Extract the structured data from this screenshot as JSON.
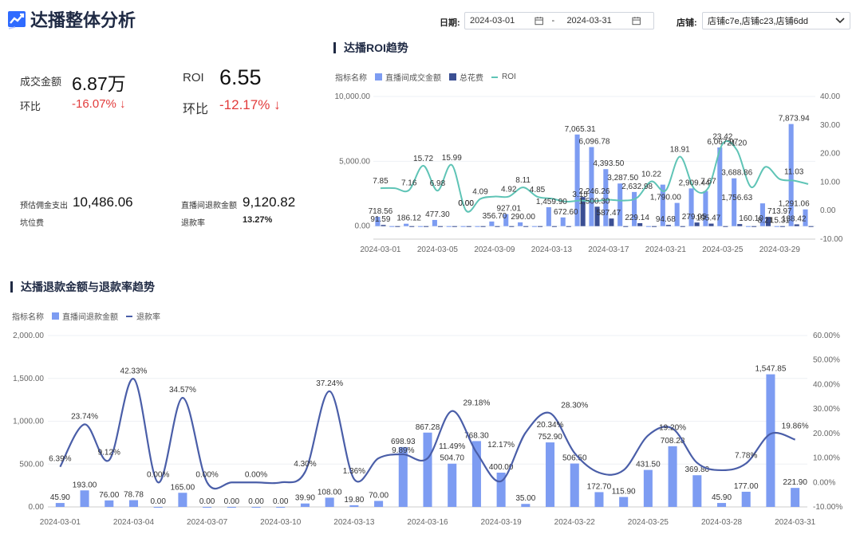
{
  "header": {
    "title": "达播整体分析",
    "date_label": "日期:",
    "date_start": "2024-03-01",
    "date_sep": "-",
    "date_end": "2024-03-31",
    "shop_label": "店铺:",
    "shop_value": "店铺c7e,店铺c23,店铺6dd"
  },
  "kpi": {
    "gmv_label": "成交金额",
    "gmv_value": "6.87万",
    "gmv_mom_label": "环比",
    "gmv_mom_value": "-16.07%",
    "roi_label": "ROI",
    "roi_value": "6.55",
    "roi_mom_label": "环比",
    "roi_mom_value": "-12.17%",
    "commission_label": "预估佣金支出",
    "commission_value": "10,486.06",
    "slot_fee_label": "坑位费",
    "refund_amount_label": "直播间退款金额",
    "refund_amount_value": "9,120.82",
    "refund_rate_label": "退款率",
    "refund_rate_value": "13.27%"
  },
  "colors": {
    "bar_light": "#7d9cf2",
    "bar_dark": "#3b4f93",
    "roi_line": "#5fc4b6",
    "refund_line": "#4a5ea8",
    "arrow_red": "#e23b3b"
  },
  "chart_data": [
    {
      "type": "bar",
      "title": "达播ROI趋势",
      "legend_title": "指标名称",
      "x": [
        "2024-03-01",
        "2024-03-02",
        "2024-03-03",
        "2024-03-04",
        "2024-03-05",
        "2024-03-06",
        "2024-03-07",
        "2024-03-08",
        "2024-03-09",
        "2024-03-10",
        "2024-03-11",
        "2024-03-12",
        "2024-03-13",
        "2024-03-14",
        "2024-03-15",
        "2024-03-16",
        "2024-03-17",
        "2024-03-18",
        "2024-03-19",
        "2024-03-20",
        "2024-03-21",
        "2024-03-22",
        "2024-03-23",
        "2024-03-24",
        "2024-03-25",
        "2024-03-26",
        "2024-03-27",
        "2024-03-28",
        "2024-03-29",
        "2024-03-30",
        "2024-03-31"
      ],
      "x_ticks": [
        "2024-03-01",
        "2024-03-05",
        "2024-03-09",
        "2024-03-13",
        "2024-03-17",
        "2024-03-21",
        "2024-03-25",
        "2024-03-29"
      ],
      "series": [
        {
          "name": "直播间成交金额",
          "kind": "bar",
          "values": [
            718.56,
            0,
            186.12,
            0,
            477.3,
            0,
            0,
            0,
            356.7,
            927.01,
            290,
            0,
            1459.9,
            672.6,
            7065.31,
            6096.78,
            4393.5,
            3287.5,
            2632.98,
            0,
            3200,
            1790,
            2909.44,
            2700,
            6067.97,
            3688.86,
            0,
            1756.63,
            0,
            7873.94,
            1291.06
          ]
        },
        {
          "name": "总花费",
          "kind": "bar",
          "values": [
            91.59,
            0,
            0,
            0,
            0,
            0,
            0,
            0,
            0,
            0,
            0,
            0,
            0,
            0,
            2246.26,
            1500.3,
            587.47,
            0,
            229.14,
            0,
            94.68,
            0,
            279.95,
            195.47,
            0,
            160.1,
            0,
            713.97,
            0,
            138.42,
            0
          ]
        },
        {
          "name": "ROI",
          "kind": "line",
          "values": [
            7.85,
            7.16,
            15.72,
            6.98,
            15.99,
            0,
            4.09,
            4.92,
            8.11,
            4.85,
            3.15,
            3.5,
            3,
            3.2,
            5,
            10.22,
            5,
            18.91,
            7.67,
            5,
            23.42,
            21.2,
            8.21,
            15.31,
            11.03,
            9.5,
            9.5,
            9.5,
            9.5,
            9.5,
            9.5
          ]
        }
      ],
      "line_points": [
        {
          "x": "2024-03-01",
          "v": 7.85
        },
        {
          "x": "2024-03-02",
          "v": 7.85
        },
        {
          "x": "2024-03-03",
          "v": 7.16
        },
        {
          "x": "2024-03-04",
          "v": 15.72
        },
        {
          "x": "2024-03-05",
          "v": 6.98
        },
        {
          "x": "2024-03-06",
          "v": 15.99
        },
        {
          "x": "2024-03-07",
          "v": 0.0
        },
        {
          "x": "2024-03-08",
          "v": 4.09
        },
        {
          "x": "2024-03-09",
          "v": 4.92
        },
        {
          "x": "2024-03-10",
          "v": 4.92
        },
        {
          "x": "2024-03-11",
          "v": 8.11
        },
        {
          "x": "2024-03-12",
          "v": 4.85
        },
        {
          "x": "2024-03-13",
          "v": 4.2
        },
        {
          "x": "2024-03-14",
          "v": 3.15
        },
        {
          "x": "2024-03-15",
          "v": 3.5
        },
        {
          "x": "2024-03-16",
          "v": 3.3
        },
        {
          "x": "2024-03-17",
          "v": 3.8
        },
        {
          "x": "2024-03-18",
          "v": 3.5
        },
        {
          "x": "2024-03-19",
          "v": 4.5
        },
        {
          "x": "2024-03-20",
          "v": 10.22
        },
        {
          "x": "2024-03-21",
          "v": 7.0
        },
        {
          "x": "2024-03-22",
          "v": 18.91
        },
        {
          "x": "2024-03-23",
          "v": 7.67
        },
        {
          "x": "2024-03-24",
          "v": 8.0
        },
        {
          "x": "2024-03-25",
          "v": 23.42
        },
        {
          "x": "2024-03-26",
          "v": 21.2
        },
        {
          "x": "2024-03-27",
          "v": 8.21
        },
        {
          "x": "2024-03-28",
          "v": 15.31
        },
        {
          "x": "2024-03-29",
          "v": 11.03
        },
        {
          "x": "2024-03-30",
          "v": 10.5
        },
        {
          "x": "2024-03-31",
          "v": 9.3
        }
      ],
      "y_left_ticks": [
        "0.00",
        "5,000.00",
        "10,000.00"
      ],
      "ylim_left": [
        -1000,
        10000
      ],
      "y_right_ticks": [
        "-10.00",
        "0.00",
        "10.00",
        "20.00",
        "30.00",
        "40.00"
      ],
      "ylim_right": [
        -10,
        40
      ],
      "labels_top": [
        {
          "i": 0,
          "t": "7.85"
        },
        {
          "i": 2,
          "t": "7.16"
        },
        {
          "i": 3,
          "t": "15.72"
        },
        {
          "i": 4,
          "t": "6.98"
        },
        {
          "i": 5,
          "t": "15.99"
        },
        {
          "i": 6,
          "t": "0.00"
        },
        {
          "i": 7,
          "t": "4.09"
        },
        {
          "i": 9,
          "t": "4.92"
        },
        {
          "i": 10,
          "t": "8.11"
        },
        {
          "i": 11,
          "t": "4.85"
        },
        {
          "i": 14,
          "t": "7,065.31"
        },
        {
          "i": 15,
          "t": "6,096.78"
        },
        {
          "i": 16,
          "t": "4,393.50"
        },
        {
          "i": 17,
          "t": "3,287.50"
        },
        {
          "i": 18,
          "t": "2,632.98"
        },
        {
          "i": 19,
          "t": "10.22"
        },
        {
          "i": 21,
          "t": "18.91"
        },
        {
          "i": 22,
          "t": "2,909.44"
        },
        {
          "i": 23,
          "t": "7.67"
        },
        {
          "i": 24,
          "t": "23.42"
        },
        {
          "i": 24,
          "t": "6,067.97"
        },
        {
          "i": 25,
          "t": "3,688.86"
        },
        {
          "i": 25,
          "t": "21.20"
        },
        {
          "i": 27,
          "t": "8.21"
        },
        {
          "i": 28,
          "t": "15.31"
        },
        {
          "i": 29,
          "t": "7,873.94"
        },
        {
          "i": 29,
          "t": "11.03"
        },
        {
          "i": 0,
          "t": "718.56"
        },
        {
          "i": 0,
          "t": "91.59"
        },
        {
          "i": 2,
          "t": "186.12"
        },
        {
          "i": 4,
          "t": "477.30"
        },
        {
          "i": 6,
          "t": "0.00"
        },
        {
          "i": 8,
          "t": "356.70"
        },
        {
          "i": 9,
          "t": "927.01"
        },
        {
          "i": 10,
          "t": "290.00"
        },
        {
          "i": 12,
          "t": "1,459.90"
        },
        {
          "i": 13,
          "t": "672.60"
        },
        {
          "i": 14,
          "t": "3.15"
        },
        {
          "i": 15,
          "t": "2,246.26"
        },
        {
          "i": 15,
          "t": "1,500.30"
        },
        {
          "i": 16,
          "t": "587.47"
        },
        {
          "i": 18,
          "t": "229.14"
        },
        {
          "i": 20,
          "t": "1,790.00"
        },
        {
          "i": 20,
          "t": "94.68"
        },
        {
          "i": 22,
          "t": "279.95"
        },
        {
          "i": 23,
          "t": "195.47"
        },
        {
          "i": 25,
          "t": "1,756.63"
        },
        {
          "i": 26,
          "t": "160.10"
        },
        {
          "i": 28,
          "t": "713.97"
        },
        {
          "i": 29,
          "t": "1,291.06"
        },
        {
          "i": 29,
          "t": "138.42"
        }
      ]
    },
    {
      "type": "bar",
      "title": "达播退款金额与退款率趋势",
      "legend_title": "指标名称",
      "x": [
        "2024-03-01",
        "2024-03-02",
        "2024-03-03",
        "2024-03-04",
        "2024-03-05",
        "2024-03-06",
        "2024-03-07",
        "2024-03-08",
        "2024-03-09",
        "2024-03-10",
        "2024-03-11",
        "2024-03-12",
        "2024-03-13",
        "2024-03-14",
        "2024-03-15",
        "2024-03-16",
        "2024-03-17",
        "2024-03-18",
        "2024-03-19",
        "2024-03-20",
        "2024-03-21",
        "2024-03-22",
        "2024-03-23",
        "2024-03-24",
        "2024-03-25",
        "2024-03-26",
        "2024-03-27",
        "2024-03-28",
        "2024-03-29",
        "2024-03-30",
        "2024-03-31"
      ],
      "x_ticks": [
        "2024-03-01",
        "2024-03-04",
        "2024-03-07",
        "2024-03-10",
        "2024-03-13",
        "2024-03-16",
        "2024-03-19",
        "2024-03-22",
        "2024-03-25",
        "2024-03-28",
        "2024-03-31"
      ],
      "series": [
        {
          "name": "直播间退款金额",
          "kind": "bar",
          "values": [
            45.9,
            193,
            76,
            78.78,
            0,
            165,
            0,
            0,
            0,
            0,
            39.9,
            108,
            19.8,
            70,
            698.93,
            867.28,
            504.7,
            768.3,
            400,
            35,
            752.9,
            506.5,
            172.7,
            115.9,
            431.5,
            708.28,
            369.8,
            45.9,
            177,
            1547.85,
            221.9
          ]
        },
        {
          "name": "退款率",
          "kind": "line",
          "values": [
            6.39,
            23.74,
            9.12,
            42.33,
            0,
            34.57,
            0,
            0,
            0,
            0,
            4.3,
            37.24,
            1.36,
            9.89,
            11.49,
            11.49,
            29.18,
            12.17,
            5,
            20.34,
            28.3,
            5,
            5,
            5,
            19.2,
            10,
            7.78,
            5,
            19.86,
            17,
            17
          ]
        }
      ],
      "bar_labels": [
        "45.90",
        "193.00",
        "76.00",
        "78.78",
        "0.00",
        "165.00",
        "0.00",
        "0.00",
        "0.00",
        "0.00",
        "39.90",
        "108.00",
        "19.80",
        "70.00",
        "698.93",
        "867.28",
        "504.70",
        "768.30",
        "400.00",
        "35.00",
        "752.90",
        "506.50",
        "172.70",
        "115.90",
        "431.50",
        "708.28",
        "369.80",
        "45.90",
        "177.00",
        "1,547.85",
        "221.90"
      ],
      "line_labels": [
        {
          "i": 0,
          "t": "6.39%",
          "v": 6.39
        },
        {
          "i": 1,
          "t": "23.74%",
          "v": 23.74
        },
        {
          "i": 2,
          "t": "9.12%",
          "v": 9.12
        },
        {
          "i": 3,
          "t": "42.33%",
          "v": 42.33
        },
        {
          "i": 4,
          "t": "0.00%",
          "v": 0
        },
        {
          "i": 5,
          "t": "34.57%",
          "v": 34.57
        },
        {
          "i": 6,
          "t": "0.00%",
          "v": 0
        },
        {
          "i": 8,
          "t": "0.00%",
          "v": 0
        },
        {
          "i": 10,
          "t": "4.30%",
          "v": 4.3
        },
        {
          "i": 11,
          "t": "37.24%",
          "v": 37.24
        },
        {
          "i": 12,
          "t": "1.36%",
          "v": 1.36
        },
        {
          "i": 14,
          "t": "9.89%",
          "v": 9.89
        },
        {
          "i": 16,
          "t": "11.49%",
          "v": 11.49
        },
        {
          "i": 17,
          "t": "29.18%",
          "v": 29.18
        },
        {
          "i": 18,
          "t": "12.17%",
          "v": 12.17
        },
        {
          "i": 20,
          "t": "20.34%",
          "v": 20.34
        },
        {
          "i": 21,
          "t": "28.30%",
          "v": 28.3
        },
        {
          "i": 25,
          "t": "19.20%",
          "v": 19.2
        },
        {
          "i": 28,
          "t": "7.78%",
          "v": 7.78
        },
        {
          "i": 30,
          "t": "19.86%",
          "v": 19.86
        }
      ],
      "line_points": [
        6.39,
        23.74,
        9.12,
        42.33,
        0,
        34.57,
        0,
        0,
        0,
        0,
        4.3,
        37.24,
        1.36,
        9.89,
        11.49,
        9.89,
        29.18,
        12.17,
        0.5,
        20.34,
        28.3,
        12,
        4,
        5,
        19.2,
        22,
        8,
        5,
        7.78,
        19.86,
        17.5
      ],
      "y_left_ticks": [
        "0.00",
        "500.00",
        "1,000.00",
        "1,500.00",
        "2,000.00"
      ],
      "ylim_left": [
        0,
        2000
      ],
      "y_right_ticks": [
        "-10.00%",
        "0.00%",
        "10.00%",
        "20.00%",
        "30.00%",
        "40.00%",
        "50.00%",
        "60.00%"
      ],
      "ylim_right": [
        -10,
        60
      ]
    }
  ]
}
